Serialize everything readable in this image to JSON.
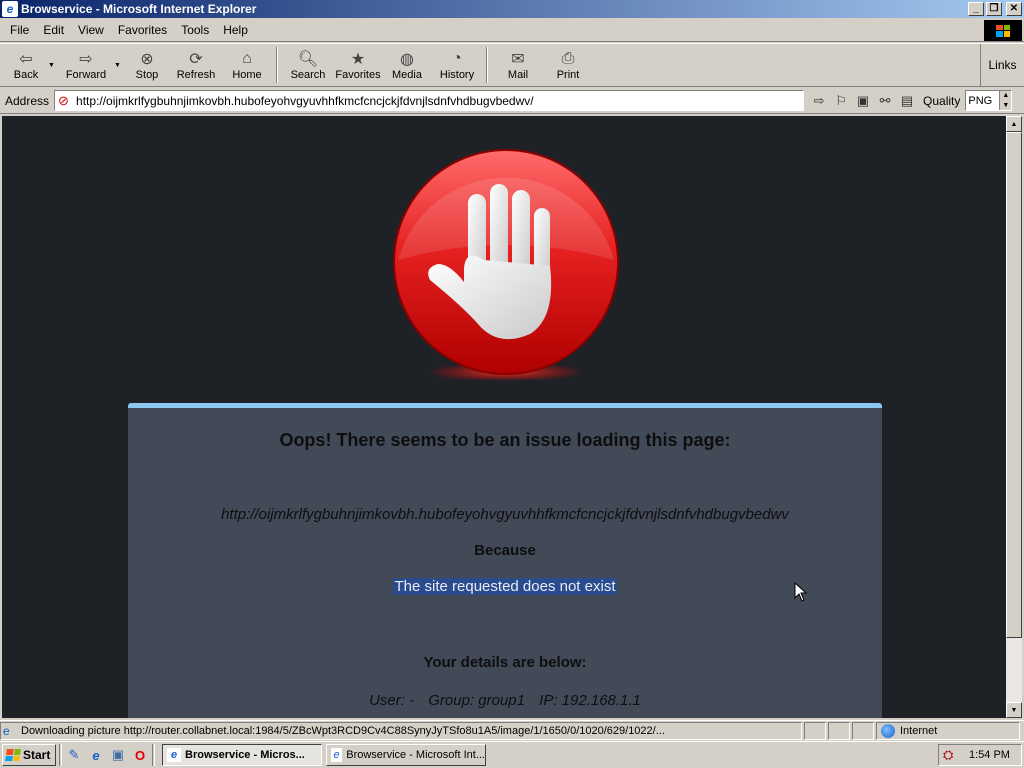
{
  "window": {
    "title": "Browservice - Microsoft Internet Explorer",
    "controls": [
      "_",
      "❐",
      "✕"
    ]
  },
  "menu": [
    "File",
    "Edit",
    "View",
    "Favorites",
    "Tools",
    "Help"
  ],
  "toolbar": {
    "back": "Back",
    "forward": "Forward",
    "stop": "Stop",
    "refresh": "Refresh",
    "home": "Home",
    "search": "Search",
    "favorites": "Favorites",
    "media": "Media",
    "history": "History",
    "mail": "Mail",
    "print": "Print",
    "links": "Links"
  },
  "address": {
    "label": "Address",
    "url": "http://oijmkrlfygbuhnjimkovbh.hubofeyohvgyuvhhfkmcfcncjckjfdvnjlsdnfvhdbugvbedwv/",
    "quality_label": "Quality",
    "quality_value": "PNG"
  },
  "page": {
    "heading": "Oops! There seems to be an issue loading this page:",
    "url": "http://oijmkrlfygbuhnjimkovbh.hubofeyohvgyuvhhfkmcfcncjckjfdvnjlsdnfvhdbugvbedwv",
    "because": "Because",
    "reason": "The site requested does not exist",
    "details_heading": "Your details are below:",
    "user": "User: -",
    "group": "Group: group1",
    "ip": "IP: 192.168.1.1",
    "colors": {
      "accent_border": "#8ec7f2",
      "panel_bg": "#434a57",
      "page_bg": "#1e2126",
      "logo_red": "#e01010"
    }
  },
  "status": {
    "text": "Downloading picture http://router.collabnet.local:1984/5/ZBcWpt3RCD9Cv4C88SynyJyTSfo8u1A5/image/1/1650/0/1020/629/1022/...",
    "zone": "Internet"
  },
  "taskbar": {
    "start": "Start",
    "tasks": [
      "Browservice - Micros...",
      "Browservice - Microsoft Int..."
    ],
    "clock": "1:54 PM"
  }
}
